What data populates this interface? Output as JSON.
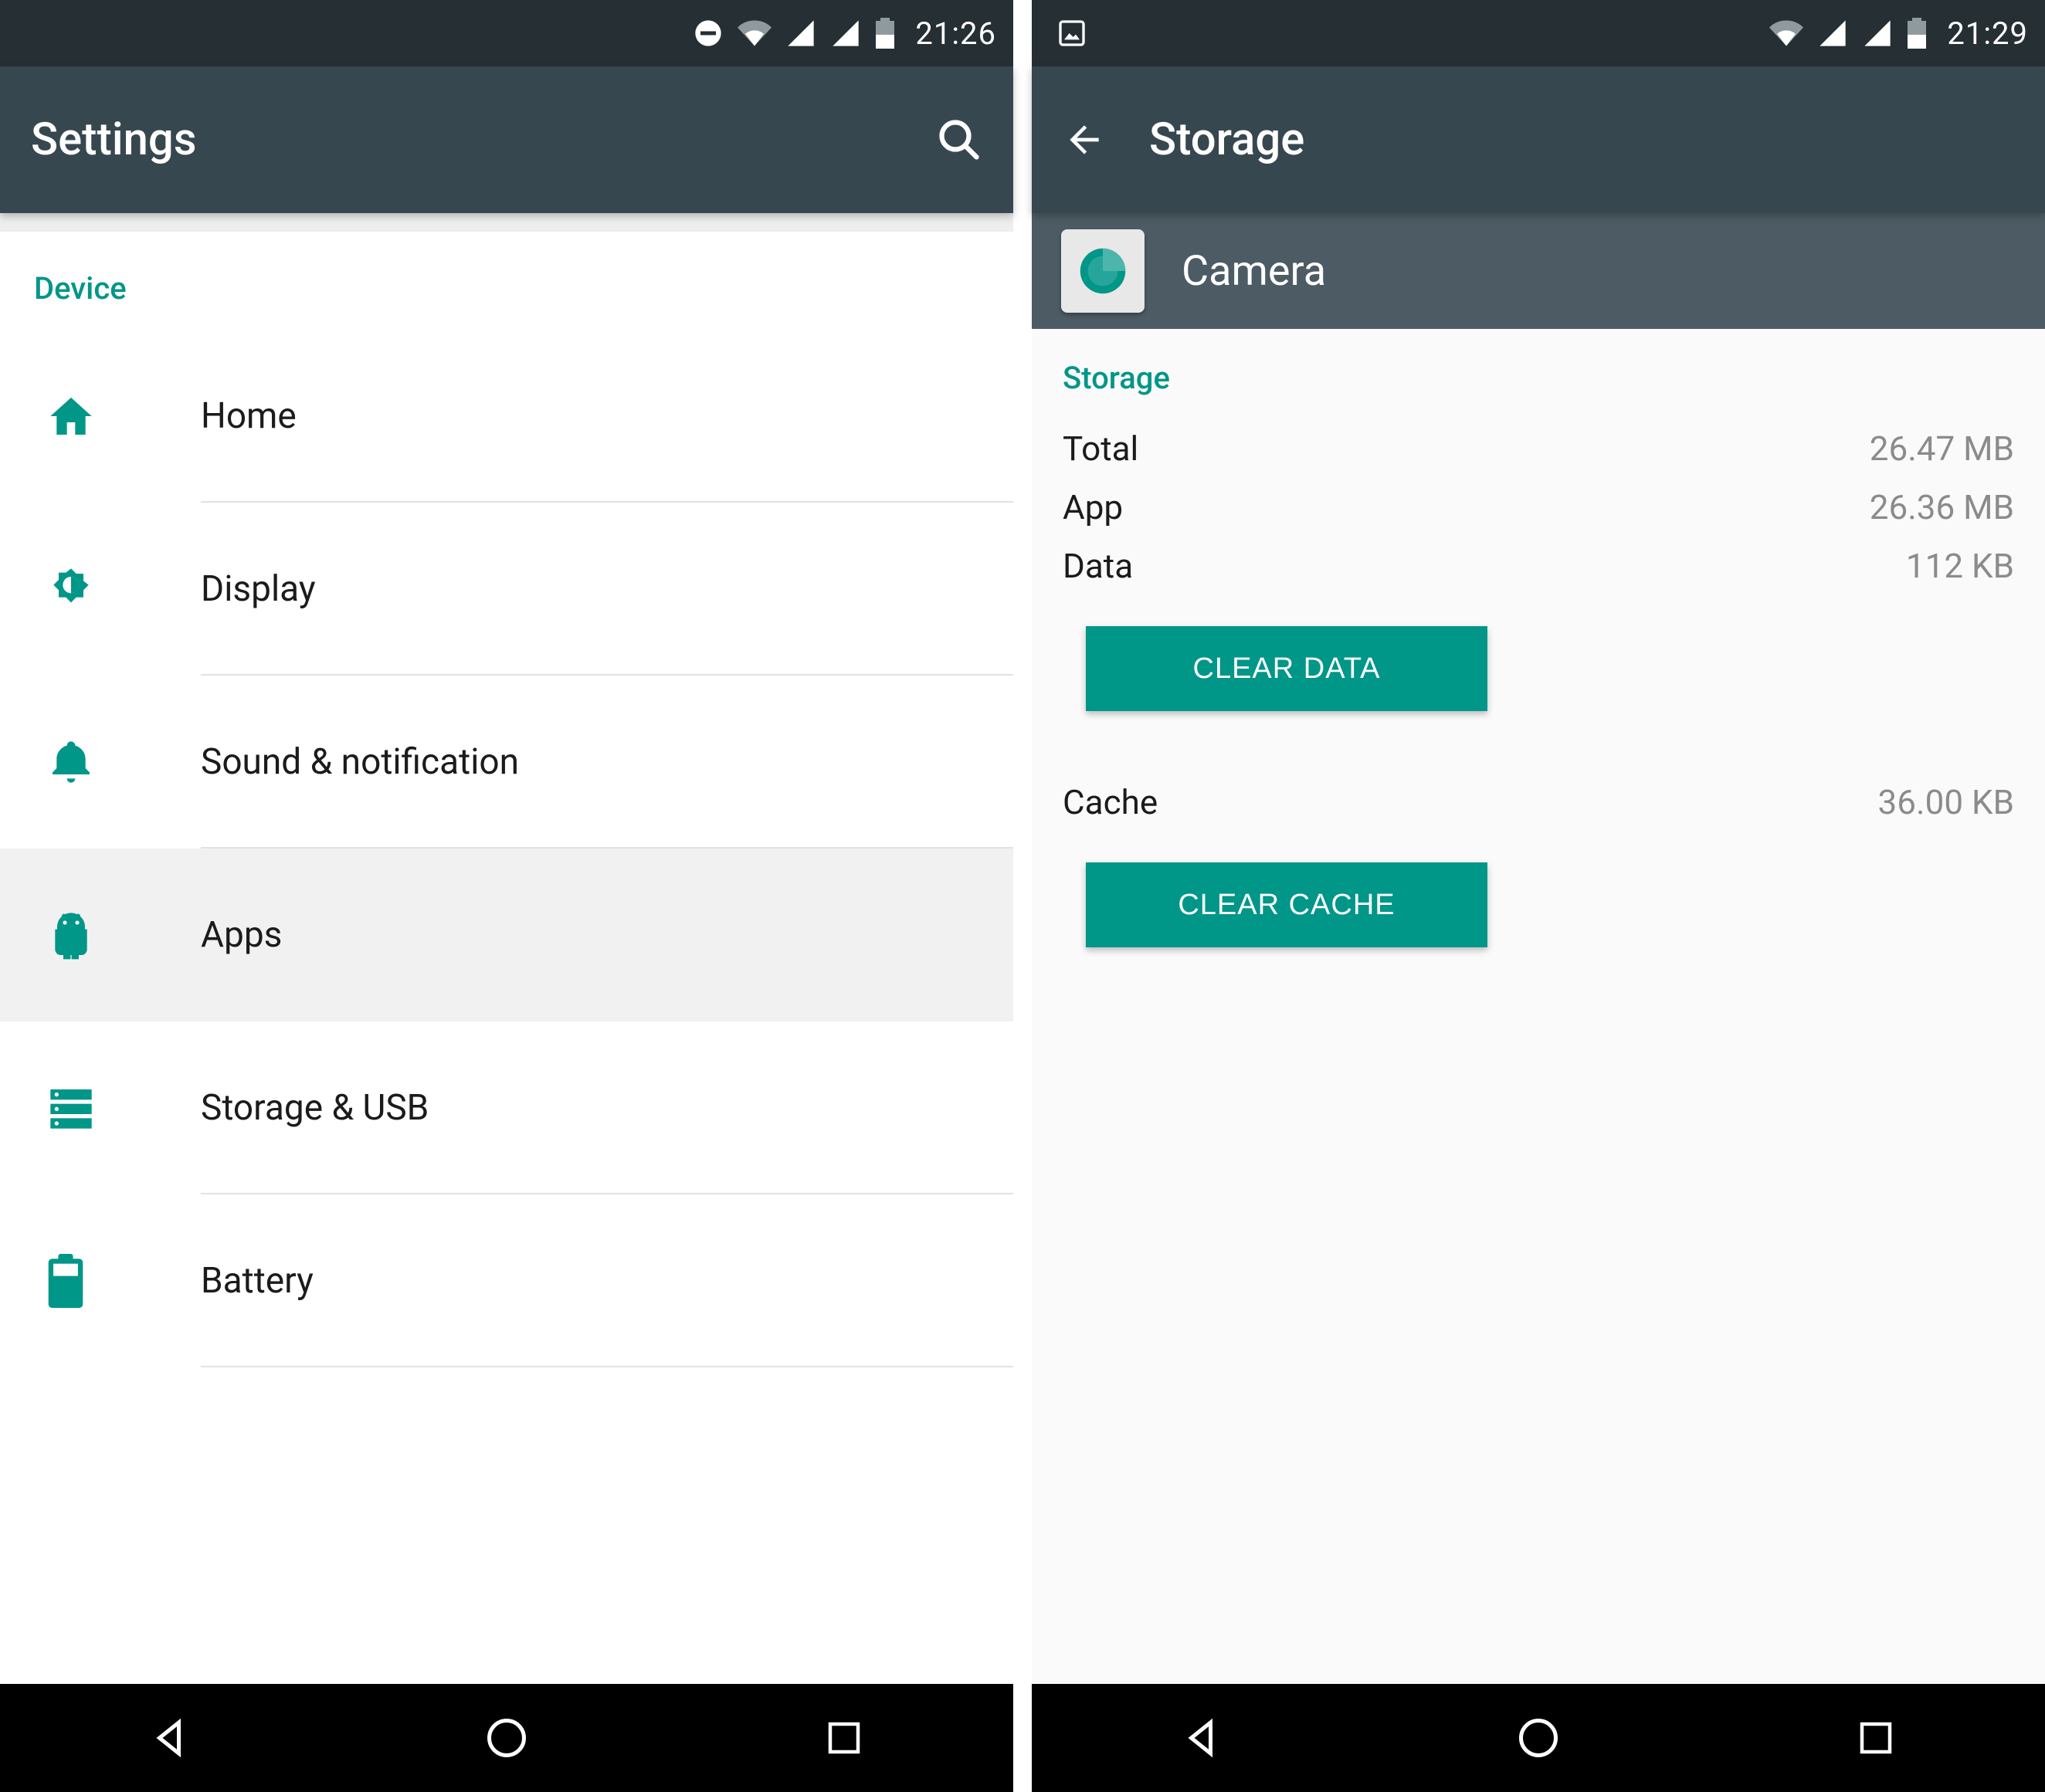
{
  "left": {
    "statusbar": {
      "time": "21:26"
    },
    "appbar": {
      "title": "Settings"
    },
    "section": "Device",
    "items": [
      {
        "label": "Home",
        "icon": "home-icon",
        "highlight": false
      },
      {
        "label": "Display",
        "icon": "brightness-icon",
        "highlight": false
      },
      {
        "label": "Sound & notification",
        "icon": "bell-icon",
        "highlight": false
      },
      {
        "label": "Apps",
        "icon": "android-icon",
        "highlight": true
      },
      {
        "label": "Storage & USB",
        "icon": "storage-icon",
        "highlight": false
      },
      {
        "label": "Battery",
        "icon": "battery-icon",
        "highlight": false
      }
    ]
  },
  "right": {
    "statusbar": {
      "time": "21:29"
    },
    "appbar": {
      "title": "Storage"
    },
    "app": {
      "name": "Camera"
    },
    "storage": {
      "section": "Storage",
      "rows": [
        {
          "k": "Total",
          "v": "26.47 MB"
        },
        {
          "k": "App",
          "v": "26.36 MB"
        },
        {
          "k": "Data",
          "v": "112 KB"
        }
      ],
      "clear_data": "CLEAR DATA",
      "cache_row": {
        "k": "Cache",
        "v": "36.00 KB"
      },
      "clear_cache": "CLEAR CACHE"
    }
  }
}
